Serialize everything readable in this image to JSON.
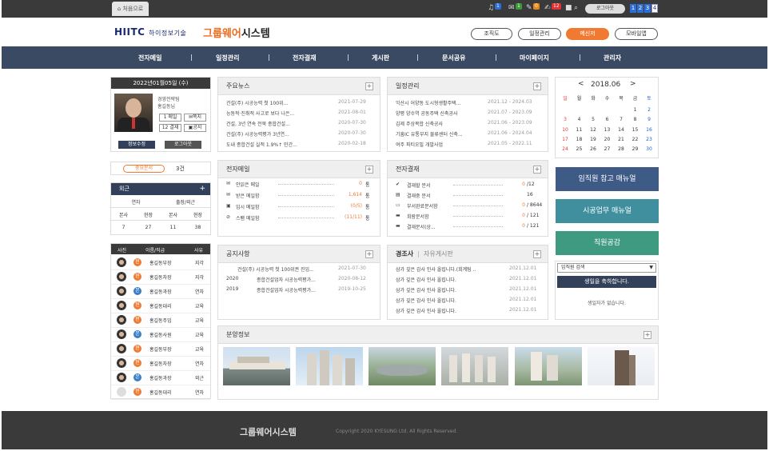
{
  "topbar": {
    "home": "처음으로",
    "badges": [
      "1",
      "1",
      "0",
      "12"
    ],
    "logout": "로그아웃",
    "pages": [
      "1",
      "2",
      "3",
      "4"
    ]
  },
  "header": {
    "logo_main": "HIITC",
    "logo_sub": "하이정보기술",
    "logo_system": "그룹웨어",
    "logo_system2": "시스템",
    "buttons": [
      "조직도",
      "일정관리",
      "메신저",
      "모바일앱"
    ]
  },
  "nav": [
    "전자메일",
    "일정관리",
    "전자결재",
    "게시판",
    "문서공유",
    "마이페이지",
    "관리자"
  ],
  "profile": {
    "date": "2022년01월05일 (수)",
    "dept": "경영전략팀",
    "name": "홍길동님",
    "mail": "1 메일",
    "memo": "쪽지",
    "approval": "12 결재",
    "notice": "공지",
    "edit": "정보수정",
    "logout": "로그아웃"
  },
  "important": {
    "label": "중요문서",
    "count": "3건"
  },
  "outside": {
    "title": "외근",
    "plus": "+",
    "col1": "연차",
    "col2": "출장/외근",
    "sub": [
      "본사",
      "현장",
      "본사",
      "현장"
    ],
    "vals": [
      "7",
      "27",
      "11",
      "38"
    ]
  },
  "staff": {
    "headers": [
      "사진",
      "이름/직급",
      "사유"
    ],
    "rows": [
      {
        "tag": "현",
        "name": "홍길동부장",
        "reason": "지각"
      },
      {
        "tag": "현",
        "name": "홍길동차장",
        "reason": "지각"
      },
      {
        "tag": "본",
        "name": "홍길동과장",
        "reason": "연차"
      },
      {
        "tag": "현",
        "name": "홍길동대리",
        "reason": "교육"
      },
      {
        "tag": "현",
        "name": "홍길동주임",
        "reason": "교육"
      },
      {
        "tag": "본",
        "name": "홍길동사원",
        "reason": "교육"
      },
      {
        "tag": "현",
        "name": "홍길동부장",
        "reason": "교육"
      },
      {
        "tag": "현",
        "name": "홍길동차장",
        "reason": "연차"
      },
      {
        "tag": "본",
        "name": "홍길동과장",
        "reason": "외근"
      },
      {
        "tag": "현",
        "name": "홍길동대리",
        "reason": "연차"
      }
    ]
  },
  "news": {
    "title": "주요뉴스",
    "items": [
      {
        "t": "건설(주) 시공능력 첫 100위...",
        "d": "2021-07-29"
      },
      {
        "t": "능동적·진취적 사고로 보다 나은...",
        "d": "2021-08-01"
      },
      {
        "t": "건설, 3년 연속 전북 종합건설...",
        "d": "2020-07-30"
      },
      {
        "t": "건설(주) 시공능력평가 3년연...",
        "d": "2020-07-30"
      },
      {
        "t": "도내 종합건설 실적 1.9%↑ 민간...",
        "d": "2020-02-18"
      }
    ]
  },
  "schedule": {
    "title": "일정관리",
    "items": [
      {
        "t": "익산시 어양동 도시형생활주택...",
        "d": "2021.12 - 2024.03"
      },
      {
        "t": "양평 양수역 공동주택 신축공사",
        "d": "2021.07 - 2023.09"
      },
      {
        "t": "김제 주상복합 신축공사",
        "d": "2021.06 - 2023.09"
      },
      {
        "t": "기흥IC 유통부지 물류센터 신축...",
        "d": "2021.06 - 2024.04"
      },
      {
        "t": "여주 파티오빌 개발사업",
        "d": "2021.05 - 2022.11"
      }
    ]
  },
  "calendar": {
    "title": "2018.06",
    "prev": "<",
    "next": ">",
    "days": [
      "일",
      "월",
      "화",
      "수",
      "목",
      "금",
      "토"
    ],
    "weeks": [
      [
        "",
        "",
        "",
        "",
        "",
        "1",
        "2"
      ],
      [
        "3",
        "4",
        "5",
        "6",
        "7",
        "8",
        "9"
      ],
      [
        "10",
        "11",
        "12",
        "13",
        "14",
        "15",
        "16"
      ],
      [
        "17",
        "18",
        "19",
        "20",
        "21",
        "22",
        "23"
      ],
      [
        "24",
        "25",
        "26",
        "27",
        "28",
        "29",
        "30"
      ]
    ],
    "colors": {
      "sun": "#e53935",
      "sat": "#1e63c9",
      "weekday": "#333333"
    }
  },
  "mail": {
    "title": "전자메일",
    "items": [
      {
        "t": "안읽은 메일",
        "v": "0",
        "u": "통"
      },
      {
        "t": "받은 메일함",
        "v": "1,614",
        "u": "통"
      },
      {
        "t": "임시 메일함",
        "v": "(0/5)",
        "u": "통"
      },
      {
        "t": "스팸 메일함",
        "v": "(11/11)",
        "u": "통"
      }
    ]
  },
  "approval": {
    "title": "전자결재",
    "items": [
      {
        "t": "결재할 문서",
        "v": "0",
        "u": "/12"
      },
      {
        "t": "결재중 문서",
        "v": "",
        "u": "16"
      },
      {
        "t": "부서완료문서함",
        "v": "0",
        "u": "/ 8644"
      },
      {
        "t": "회람문서함",
        "v": "0",
        "u": "/ 121"
      },
      {
        "t": "결재문서(상...",
        "v": "0",
        "u": "/ 121"
      }
    ]
  },
  "buttons_right": [
    {
      "label": "임직원 참고 매뉴얼",
      "color": "#3e5a86"
    },
    {
      "label": "시공업무 매뉴얼",
      "color": "#3f8f9e"
    },
    {
      "label": "직원공감",
      "color": "#3f9a82"
    }
  ],
  "notice": {
    "title": "공지사항",
    "items": [
      {
        "y": "",
        "t": "건설(주) 시공능력 첫 100위권 진입...",
        "d": "2021-07-30"
      },
      {
        "y": "2020",
        "t": "종합건설업자 시공능력평가...",
        "d": "2020-08-12"
      },
      {
        "y": "2019",
        "t": "종합건설업자 시공능력평가...",
        "d": "2019-10-25"
      }
    ]
  },
  "events": {
    "title": "경조사",
    "tab2": "자유게시판",
    "items": [
      {
        "t": "삼가 깊은 감사 인사 올립니다.(회계팀 ..",
        "d": "2021.12.01"
      },
      {
        "t": "삼가 깊은 감사 인사 올립니다.",
        "d": "2021.12.01"
      },
      {
        "t": "삼가 깊은 감사 인사 올립니다.",
        "d": "2021.12.01"
      },
      {
        "t": "삼가 깊은 감사 인사 올립니다.",
        "d": "2021.12.01"
      },
      {
        "t": "삼가 깊은 감사 인사 올립니다.",
        "d": "2021.12.01"
      }
    ]
  },
  "birthday": {
    "select": "임직원 검색",
    "banner": "생일을 축하합니다.",
    "empty": "생일자가 없습니다."
  },
  "sale": {
    "title": "분양정보"
  },
  "footer": {
    "brand": "그룹웨어시스템",
    "copy": "Copyright 2020 KYESUNG Ltd. All Rights Reserved."
  }
}
